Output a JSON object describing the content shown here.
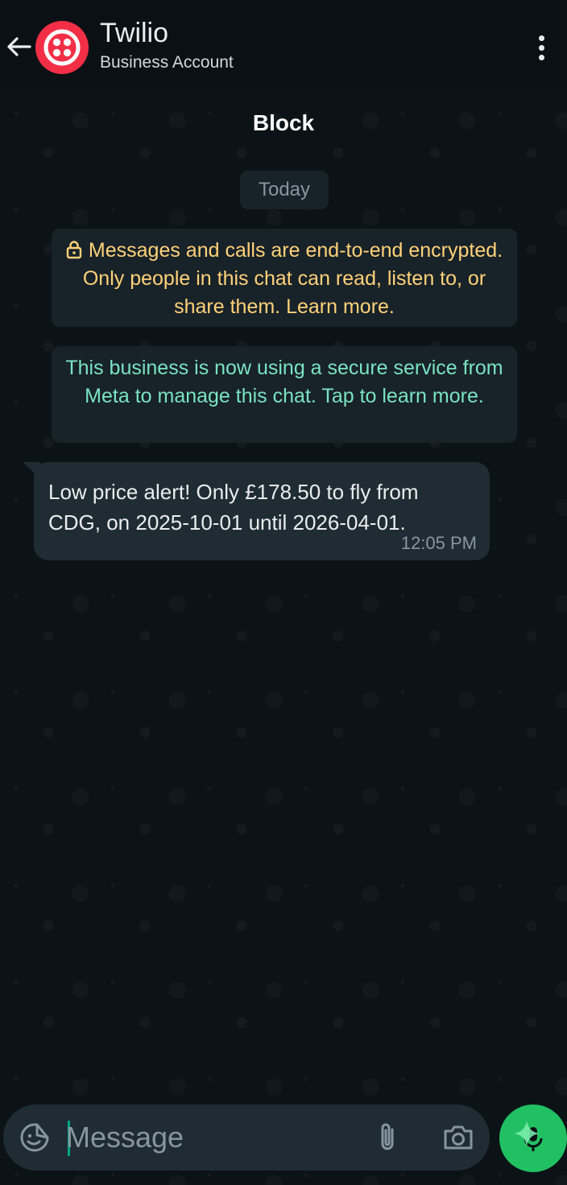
{
  "header": {
    "title": "Twilio",
    "subtitle": "Business Account"
  },
  "actions": {
    "block_label": "Block"
  },
  "chat": {
    "date_label": "Today",
    "encryption_notice": "Messages and calls are end-to-end encrypted. Only people in this chat can read, listen to, or share them. Learn more.",
    "business_notice": "This business is now using a secure service from Meta to manage this chat. Tap to learn more.",
    "messages": [
      {
        "text": "Low price alert! Only £178.50 to fly from\nCDG, on 2025-10-01 until 2026-04-01.",
        "time": "12:05 PM"
      }
    ]
  },
  "composer": {
    "placeholder": "Message"
  },
  "colors": {
    "avatar_brand": "#f22f46",
    "send_button": "#21c063",
    "encryption_text": "#ffd279",
    "business_text": "#7ae3c3"
  },
  "icons": [
    "back-arrow-icon",
    "twilio-logo-icon",
    "more-options-icon",
    "lock-icon",
    "sticker-icon",
    "attach-icon",
    "camera-icon",
    "mic-icon"
  ]
}
